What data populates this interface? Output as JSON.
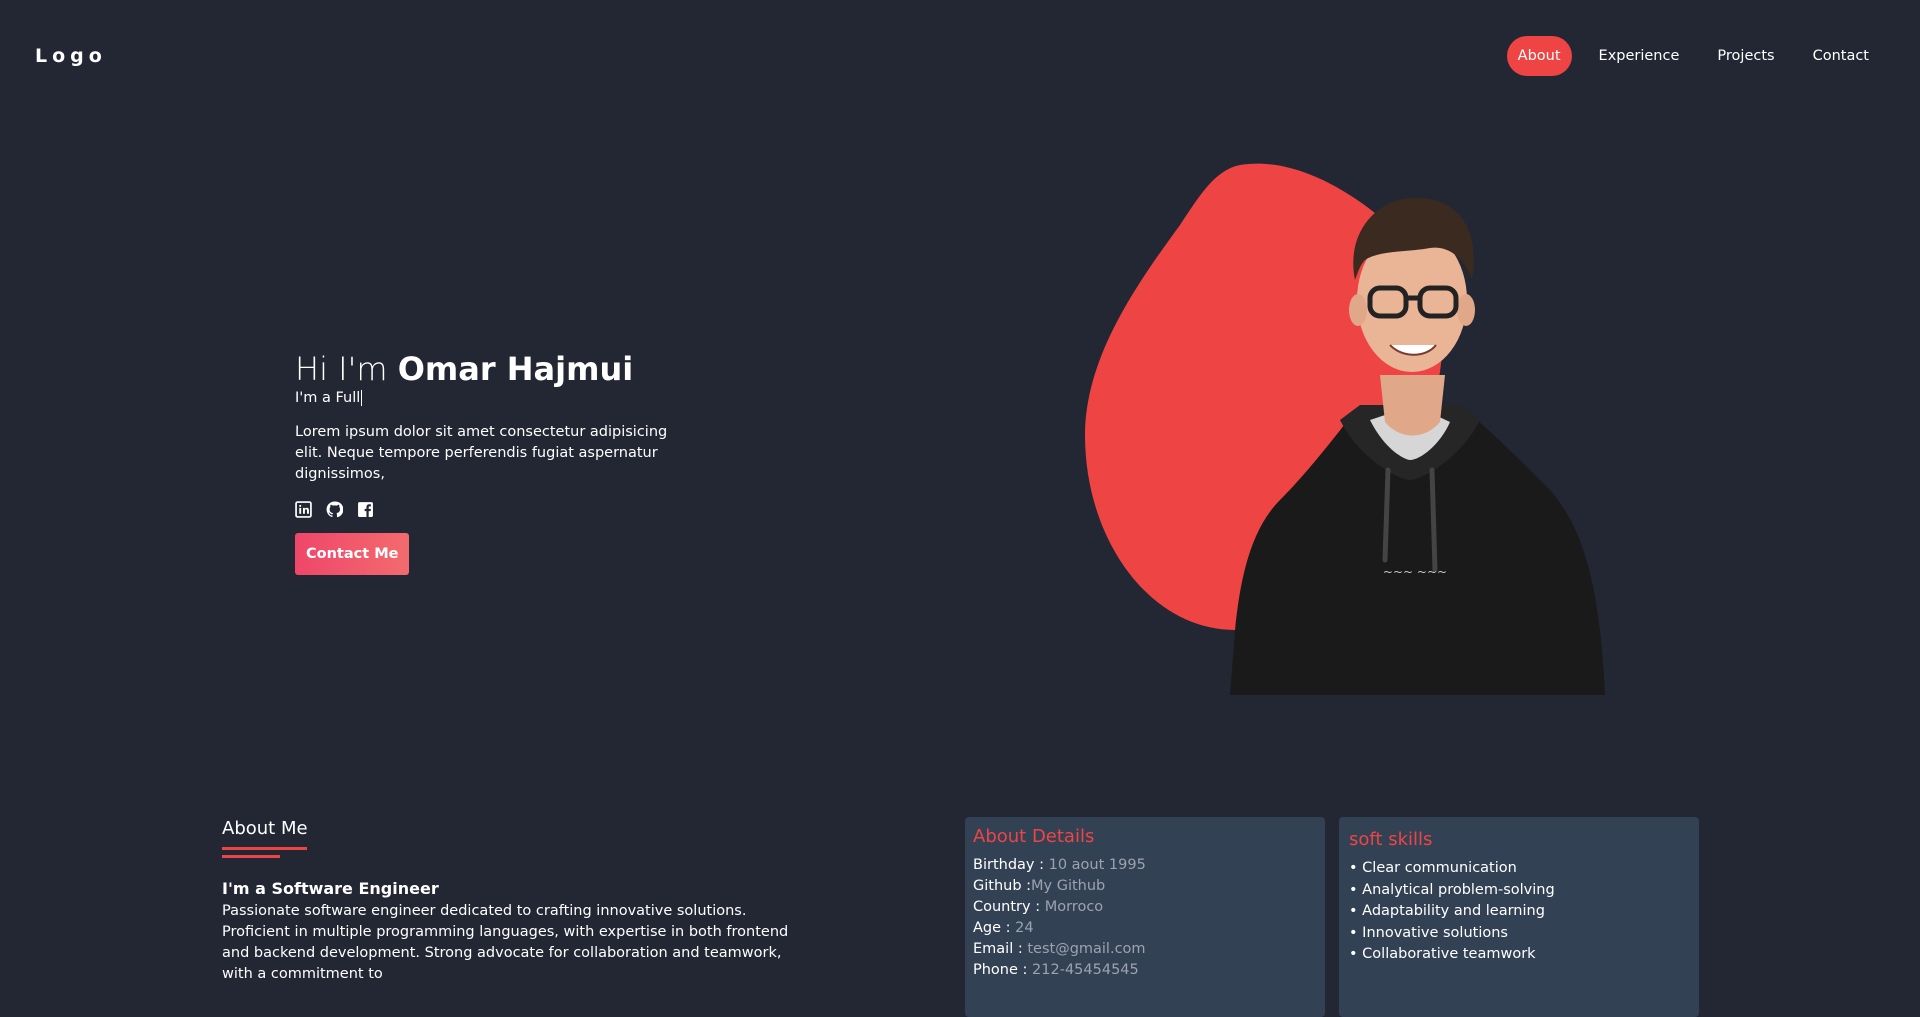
{
  "nav": {
    "logo": "Logo",
    "links": [
      "About",
      "Experience",
      "Projects",
      "Contact"
    ],
    "active": "About"
  },
  "hero": {
    "greeting": "Hi I'm",
    "name": "Omar Hajmui",
    "role": "I'm a Full",
    "description": "Lorem ipsum dolor sit amet consectetur adipisicing elit. Neque tempore perferendis fugiat aspernatur dignissimos,",
    "socials": [
      "linkedin-icon",
      "github-icon",
      "facebook-icon"
    ],
    "cta": "Contact Me"
  },
  "about": {
    "heading": "About Me",
    "subtitle": "I'm a Software Engineer",
    "text": "Passionate software engineer dedicated to crafting innovative solutions. Proficient in multiple programming languages, with expertise in both frontend and backend development. Strong advocate for collaboration and teamwork, with a commitment to"
  },
  "details": {
    "title": "About Details",
    "rows": [
      {
        "label": "Birthday :",
        "value": " 10 aout 1995"
      },
      {
        "label": "Github :",
        "value": "My Github"
      },
      {
        "label": "Country :",
        "value": " Morroco"
      },
      {
        "label": "Age :",
        "value": " 24"
      },
      {
        "label": "Email :",
        "value": " test@gmail.com"
      },
      {
        "label": "Phone :",
        "value": " 212-45454545"
      }
    ]
  },
  "skills": {
    "title": "soft skills",
    "items": [
      "Clear communication",
      "Analytical problem-solving",
      "Adaptability and learning",
      "Innovative solutions",
      "Collaborative teamwork"
    ]
  },
  "colors": {
    "background": "#222733",
    "accent": "#ef4444",
    "card": "#334155"
  }
}
